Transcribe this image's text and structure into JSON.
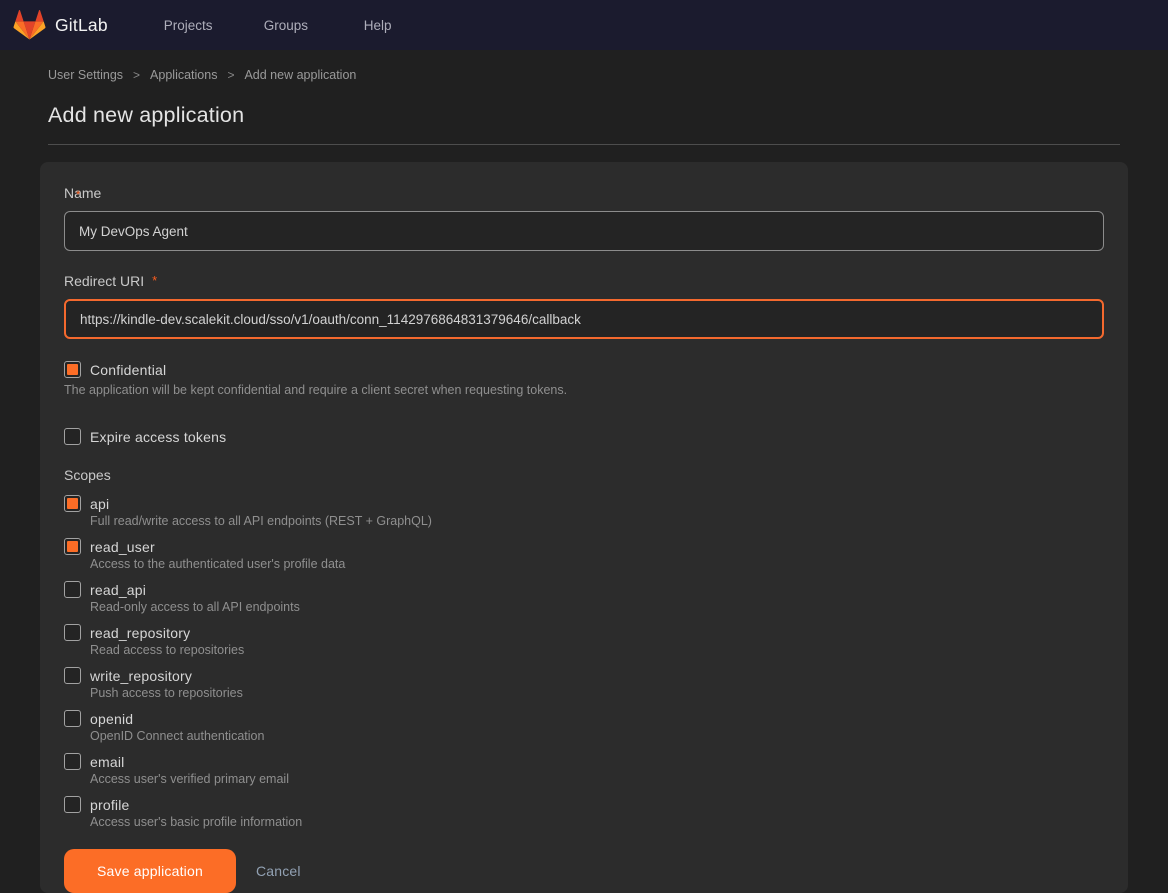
{
  "navbar": {
    "brand": "GitLab",
    "items": [
      {
        "label": "Projects"
      },
      {
        "label": "Groups"
      },
      {
        "label": "Help"
      }
    ]
  },
  "breadcrumb": {
    "separator": ">",
    "items": [
      "User Settings",
      "Applications",
      "Add new application"
    ]
  },
  "page": {
    "title": "Add new application"
  },
  "form": {
    "required_mark": "*",
    "name": {
      "label": "Name",
      "value": "My DevOps Agent"
    },
    "redirect_uri": {
      "label": "Redirect URI",
      "value": "https://kindle-dev.scalekit.cloud/sso/v1/oauth/conn_1142976864831379646/callback"
    },
    "confidential": {
      "label": "Confidential",
      "description": "The application will be kept confidential and require a client secret when requesting tokens.",
      "checked": true
    },
    "expire_tokens": {
      "label": "Expire access tokens",
      "checked": false
    },
    "scopes": {
      "label": "Scopes",
      "items": [
        {
          "name": "api",
          "description": "Full read/write access to all API endpoints (REST + GraphQL)",
          "checked": true
        },
        {
          "name": "read_user",
          "description": "Access to the authenticated user's profile data",
          "checked": true
        },
        {
          "name": "read_api",
          "description": "Read-only access to all API endpoints",
          "checked": false
        },
        {
          "name": "read_repository",
          "description": "Read access to repositories",
          "checked": false
        },
        {
          "name": "write_repository",
          "description": "Push access to repositories",
          "checked": false
        },
        {
          "name": "openid",
          "description": "OpenID Connect authentication",
          "checked": false
        },
        {
          "name": "email",
          "description": "Access user's verified primary email",
          "checked": false
        },
        {
          "name": "profile",
          "description": "Access user's basic profile information",
          "checked": false
        }
      ]
    },
    "actions": {
      "save_label": "Save application",
      "cancel_label": "Cancel"
    }
  },
  "colors": {
    "accent": "#fc6d26",
    "navbar_bg": "#1b1b2e",
    "page_bg": "#202020",
    "card_bg": "#2c2c2c",
    "focus_border": "#f4692e",
    "cancel_text": "#92a1b3"
  }
}
